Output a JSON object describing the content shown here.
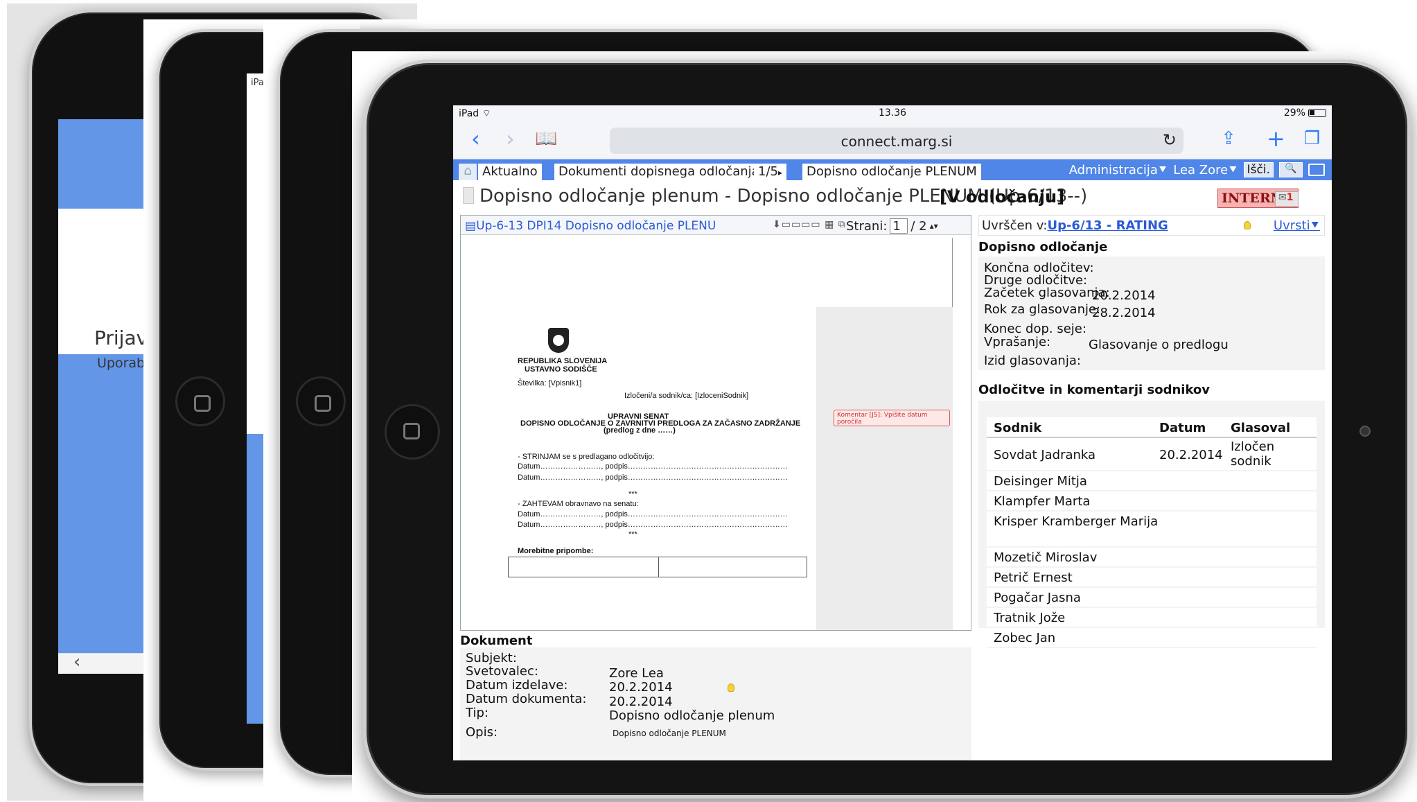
{
  "bg_devices": {
    "prijav": "Prijav",
    "uporab": "Uporab",
    "ipa": "iPa",
    "back_glyph": "‹"
  },
  "status": {
    "device": "iPad",
    "time": "13.36",
    "battery": "29%"
  },
  "browser": {
    "url": "connect.marg.si"
  },
  "nav": {
    "breadcrumbs": [
      "Aktualno",
      "Dokumenti dopisnega odločanja",
      "1/5",
      "Dopisno odločanje PLENUM"
    ],
    "admin": "Administracija",
    "user": "Lea Zore",
    "search": "Išči."
  },
  "title": {
    "text": "Dopisno odločanje plenum - Dopisno odločanje PLENUM (Up-6/13--)",
    "state": "[V odločanju]",
    "badge": "INTERNO",
    "mail_count": "1"
  },
  "preview": {
    "link": "Up-6-13  DPI14  Dopisno odločanje PLENU",
    "page_label": "Strani:",
    "page_current": "1",
    "page_total": "/ 2",
    "doc": {
      "org1": "REPUBLIKA SLOVENIJA",
      "org2": "USTAVNO SODIŠČE",
      "stevilka": "Številka:  [Vpisnik1]",
      "izloceni": "Izločeni/a sodnik/ca: [IzloceniSodnik]",
      "senat": "UPRAVNI SENAT",
      "heading": "DOPISNO ODLOČANJE O ZAVRNITVI PREDLOGA ZA ZAČASNO ZADRŽANJE",
      "predlog": "(predlog z dne ……)",
      "strinjam": "- STRINJAM se s predlagano odločitvijo:",
      "datum_line": "Datum……………………, podpis………………………………………………………",
      "stars": "***",
      "zahtevam": "- ZAHTEVAM obravnavo na senatu:",
      "pripombe": "Morebitne pripombe:",
      "comment": "Komentar [JS]: Vpišite datum poročila"
    }
  },
  "dokument": {
    "heading": "Dokument",
    "labels": [
      "Subjekt:",
      "Svetovalec:",
      "Datum izdelave:",
      "Datum dokumenta:",
      "Tip:",
      "Opis:"
    ],
    "values": [
      "",
      "Zore Lea",
      "20.2.2014",
      "20.2.2014",
      "Dopisno odločanje plenum",
      "Dopisno odločanje PLENUM"
    ]
  },
  "right": {
    "uvrscen_label": "Uvrščen v:",
    "uvrscen_link": "Up-6/13 - RATING",
    "uvrsti": "Uvrsti",
    "dopisno_heading": "Dopisno odločanje",
    "fields": [
      "Končna odločitev:",
      "Druge odločitve:",
      "Začetek glasovanja:",
      "Rok za glasovanje:",
      "Konec dop. seje:",
      "Vprašanje:",
      "Izid glasovanja:"
    ],
    "values": [
      "",
      "",
      "20.2.2014",
      "28.2.2014",
      "",
      "Glasovanje o predlogu",
      ""
    ],
    "odlocitve_heading": "Odločitve in komentarji sodnikov",
    "columns": [
      "Sodnik",
      "Datum",
      "Glasoval"
    ],
    "rows": [
      {
        "sodnik": "Sovdat Jadranka",
        "datum": "20.2.2014",
        "glasoval": "Izločen sodnik"
      },
      {
        "sodnik": "Deisinger Mitja",
        "datum": "",
        "glasoval": ""
      },
      {
        "sodnik": "Klampfer Marta",
        "datum": "",
        "glasoval": ""
      },
      {
        "sodnik": "Krisper Kramberger Marija",
        "datum": "",
        "glasoval": ""
      },
      {
        "sodnik": "Mozetič Miroslav",
        "datum": "",
        "glasoval": ""
      },
      {
        "sodnik": "Petrič Ernest",
        "datum": "",
        "glasoval": ""
      },
      {
        "sodnik": "Pogačar Jasna",
        "datum": "",
        "glasoval": ""
      },
      {
        "sodnik": "Tratnik Jože",
        "datum": "",
        "glasoval": ""
      },
      {
        "sodnik": "Zobec Jan",
        "datum": "",
        "glasoval": ""
      }
    ]
  },
  "colors": {
    "accent": "#4f86e8",
    "link": "#2a5bd7",
    "badge": "#f6b3b3"
  }
}
